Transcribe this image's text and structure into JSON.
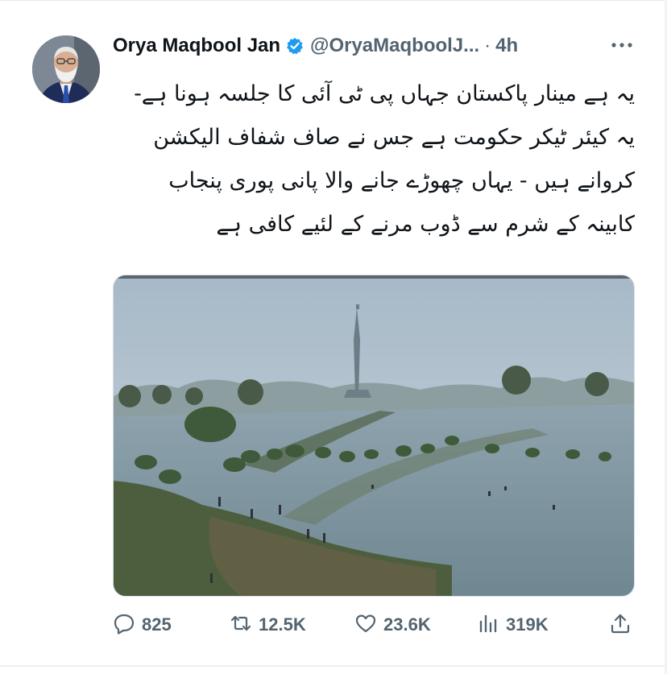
{
  "tweet": {
    "author_name": "Orya Maqbool Jan",
    "handle": "@OryaMaqboolJ...",
    "separator": "·",
    "time": "4h",
    "text": "یہ ہے مینار پاکستان جہاں پی ٹی آئی کا جلسہ ہونا ہے- یہ کیئر ٹیکر حکومت ہے جس نے صاف شفاف الیکشن کروانے ہیں - یہاں چھوڑے جانے والا پانی پوری پنجاب کابینہ کے شرم سے ڈوب مرنے کے لئیے کافی ہے"
  },
  "actions": {
    "replies": "825",
    "retweets": "12.5K",
    "likes": "23.6K",
    "views": "319K"
  },
  "icons": {
    "verified": "verified-badge-icon",
    "more": "more-options-icon",
    "reply": "reply-icon",
    "retweet": "retweet-icon",
    "like": "heart-icon",
    "views": "views-bar-chart-icon",
    "share": "share-icon"
  },
  "colors": {
    "verified_blue": "#1d9bf0",
    "secondary_text": "#536471",
    "primary_text": "#0f1419"
  }
}
